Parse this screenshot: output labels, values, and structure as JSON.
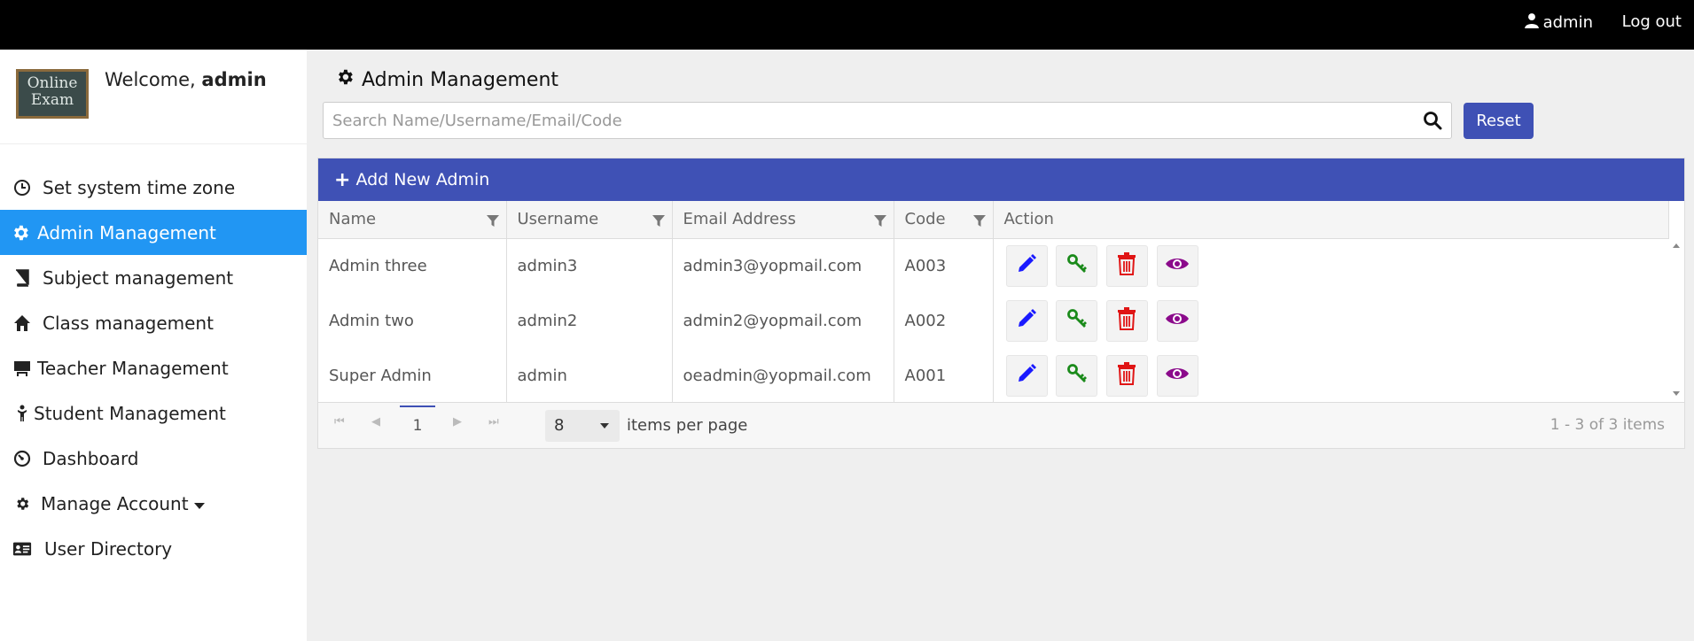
{
  "topbar": {
    "user_label": "admin",
    "logout_label": "Log out"
  },
  "sidebar": {
    "logo_line1": "Online",
    "logo_line2": "Exam",
    "welcome_prefix": "Welcome,",
    "welcome_user": "admin",
    "items": [
      {
        "label": "Set system time zone",
        "icon": "clock-icon"
      },
      {
        "label": "Admin Management",
        "icon": "gear-icon",
        "active": true
      },
      {
        "label": "Subject management",
        "icon": "book-icon"
      },
      {
        "label": "Class management",
        "icon": "home-icon"
      },
      {
        "label": "Teacher Management",
        "icon": "presentation-icon"
      },
      {
        "label": "Student Management",
        "icon": "child-icon"
      },
      {
        "label": "Dashboard",
        "icon": "dashboard-icon"
      },
      {
        "label": "Manage Account",
        "icon": "gear-icon"
      },
      {
        "label": "User Directory",
        "icon": "id-card-icon"
      }
    ]
  },
  "main": {
    "title": "Admin Management",
    "search_placeholder": "Search Name/Username/Email/Code",
    "reset_label": "Reset",
    "add_label": "Add New Admin",
    "columns": [
      "Name",
      "Username",
      "Email Address",
      "Code",
      "Action"
    ],
    "rows": [
      {
        "name": "Admin three",
        "username": "admin3",
        "email": "admin3@yopmail.com",
        "code": "A003"
      },
      {
        "name": "Admin two",
        "username": "admin2",
        "email": "admin2@yopmail.com",
        "code": "A002"
      },
      {
        "name": "Super Admin",
        "username": "admin",
        "email": "oeadmin@yopmail.com",
        "code": "A001"
      }
    ],
    "pager": {
      "current_page": "1",
      "page_size": "8",
      "items_per_page_label": "items per page",
      "range_label": "1 - 3 of 3 items"
    }
  },
  "colors": {
    "accent": "#3f51b5",
    "active_nav": "#2196f3",
    "edit": "#1a1aff",
    "key": "#1a8a1a",
    "delete": "#e01515",
    "view": "#8b0a8b"
  }
}
